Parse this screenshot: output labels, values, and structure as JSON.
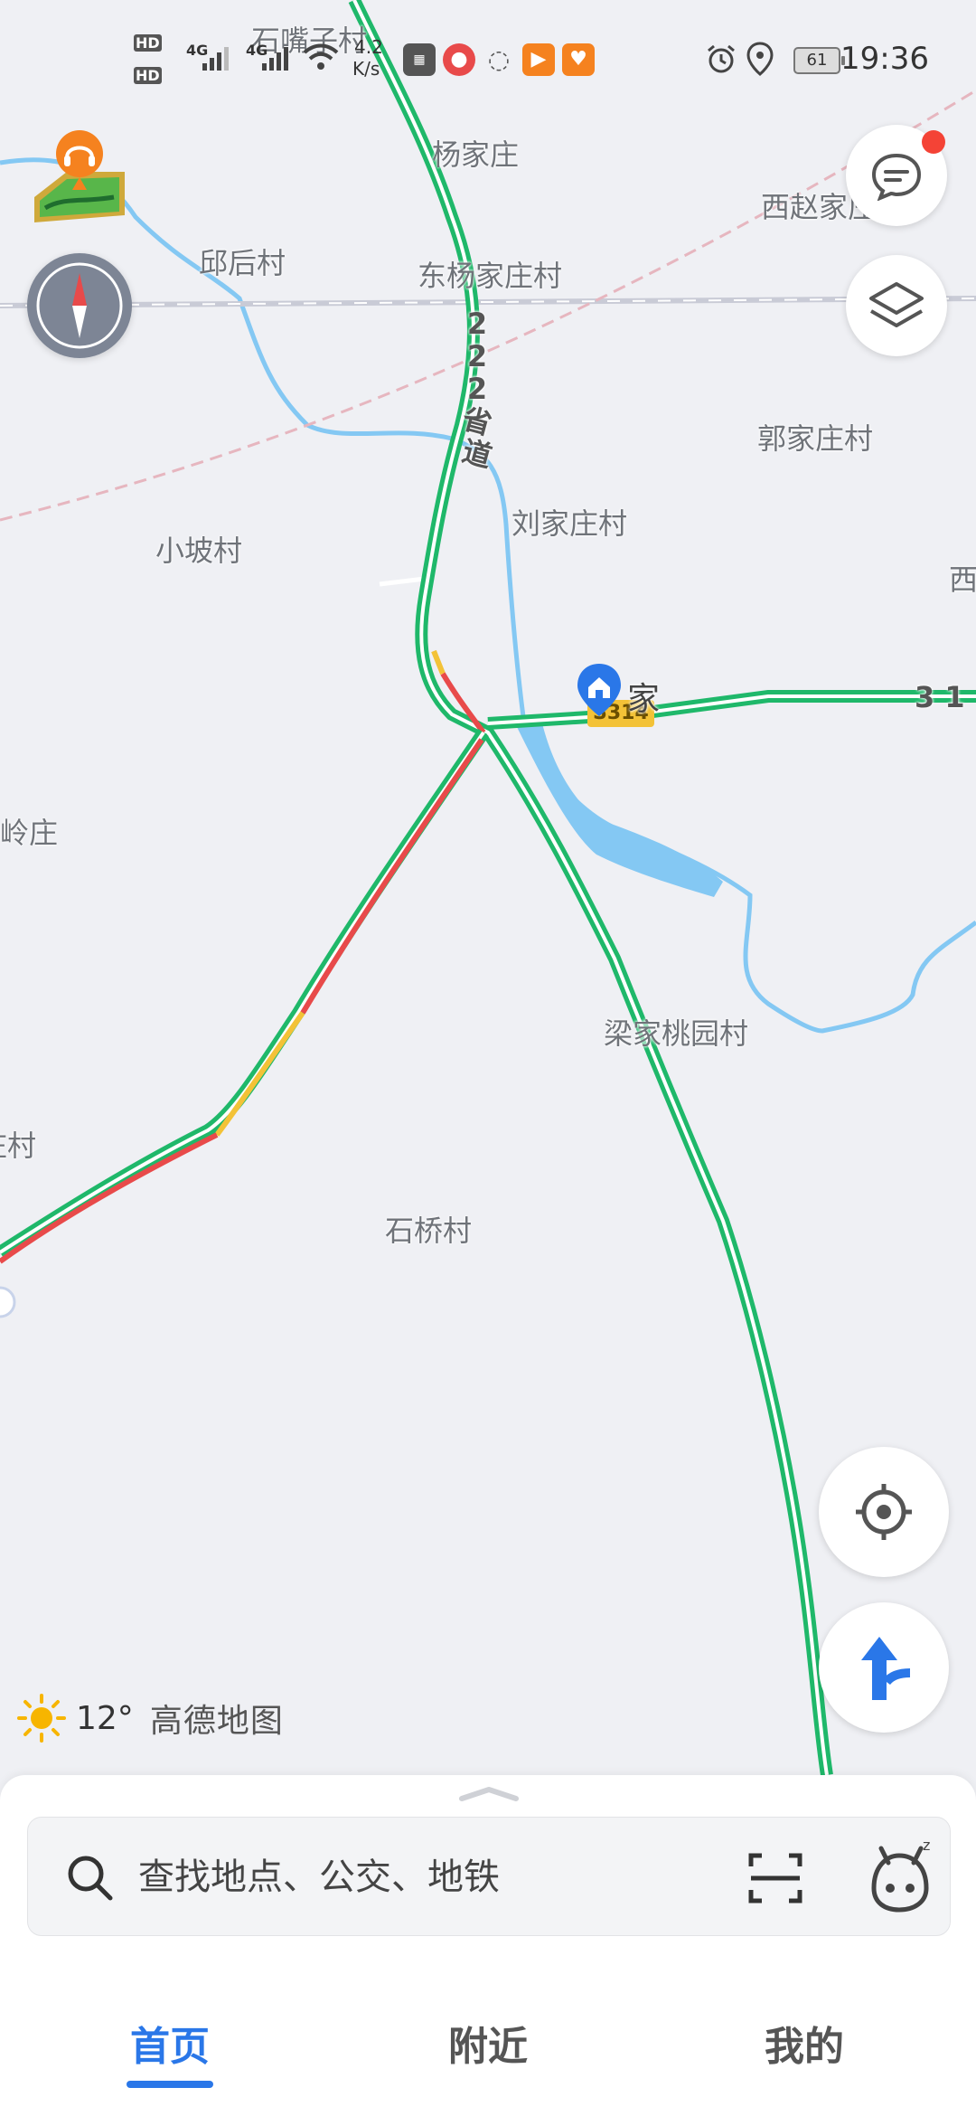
{
  "status_bar": {
    "hd1": "HD",
    "hd2": "HD",
    "net1": "4G",
    "net2": "4G",
    "speed_value": "4.2",
    "speed_unit": "K/s",
    "battery": "61",
    "time": "19:36"
  },
  "map": {
    "places": [
      "石嘴子村",
      "杨家庄",
      "西赵家庄",
      "邱后村",
      "东杨家庄村",
      "郭家庄村",
      "刘家庄村",
      "小坡村",
      "西",
      "岭庄",
      "梁家桃园村",
      "庄村",
      "石桥村"
    ],
    "road_name_vertical": [
      "2",
      "2",
      "2",
      "省",
      "道"
    ],
    "road_badge": "S314",
    "road_label_right": "3 1",
    "home_label": "家"
  },
  "weather": {
    "temperature": "12°",
    "brand": "高德地图"
  },
  "search": {
    "placeholder": "查找地点、公交、地铁"
  },
  "tabs": [
    {
      "label": "首页",
      "active": true
    },
    {
      "label": "附近",
      "active": false
    },
    {
      "label": "我的",
      "active": false
    }
  ],
  "colors": {
    "accent": "#2a77e8",
    "road_green": "#1fb86a",
    "traffic_red": "#e84a4a",
    "traffic_yellow": "#f3c237",
    "water": "#84c8f3",
    "notification": "#f44336"
  }
}
